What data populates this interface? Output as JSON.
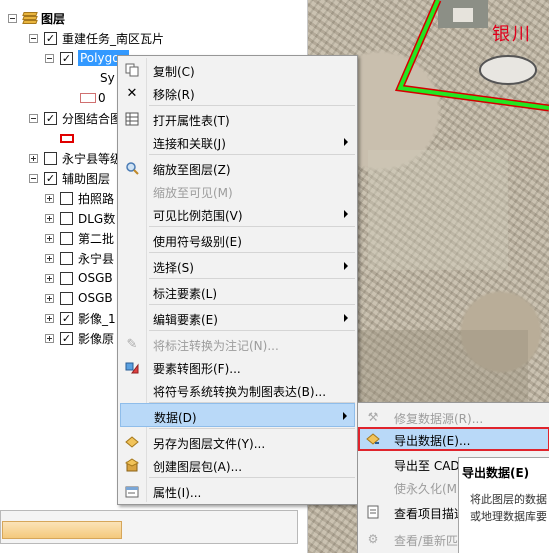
{
  "toc": {
    "root": "图层",
    "layer1": "重建任务_南区瓦片",
    "layer1_child": "Polygon",
    "sym_text": "Sy",
    "legend_value": "0",
    "layer2": "分图结合图",
    "layer3": "永宁县等级",
    "layer4": "辅助图层",
    "sub": [
      "拍照路",
      "DLG数",
      "第二批",
      "永宁县",
      "OSGB",
      "OSGB",
      "影像_1",
      "影像原"
    ]
  },
  "map": {
    "label": "银川"
  },
  "context_menu": {
    "items": [
      {
        "label": "复制(C)",
        "icon": "copy-icon"
      },
      {
        "label": "移除(R)",
        "icon": "remove-icon"
      },
      {
        "label": "打开属性表(T)",
        "icon": "table-icon"
      },
      {
        "label": "连接和关联(J)",
        "icon": ""
      },
      {
        "label": "缩放至图层(Z)",
        "icon": "zoom-layer-icon"
      },
      {
        "label": "缩放至可见(M)",
        "icon": ""
      },
      {
        "label": "可见比例范围(V)",
        "icon": ""
      },
      {
        "label": "使用符号级别(E)",
        "icon": ""
      },
      {
        "label": "选择(S)",
        "icon": ""
      },
      {
        "label": "标注要素(L)",
        "icon": ""
      },
      {
        "label": "编辑要素(E)",
        "icon": ""
      },
      {
        "label": "将标注转换为注记(N)...",
        "icon": "annotation-icon"
      },
      {
        "label": "要素转图形(F)...",
        "icon": "graphics-icon"
      },
      {
        "label": "将符号系统转换为制图表达(B)...",
        "icon": ""
      },
      {
        "label": "数据(D)",
        "icon": ""
      },
      {
        "label": "另存为图层文件(Y)...",
        "icon": "layer-file-icon"
      },
      {
        "label": "创建图层包(A)...",
        "icon": "layer-package-icon"
      },
      {
        "label": "属性(I)...",
        "icon": "properties-icon"
      }
    ]
  },
  "submenu": {
    "items": [
      {
        "label": "修复数据源(R)..."
      },
      {
        "label": "导出数据(E)..."
      },
      {
        "label": "导出至 CAD"
      },
      {
        "label": "使永久化(M)"
      },
      {
        "label": "查看项目描述"
      },
      {
        "label": "查看/重新匹配地址(Y)"
      }
    ]
  },
  "tooltip": {
    "title": "导出数据(E)",
    "desc_line1": "将此图层的数据",
    "desc_line2": "或地理数据库要"
  }
}
